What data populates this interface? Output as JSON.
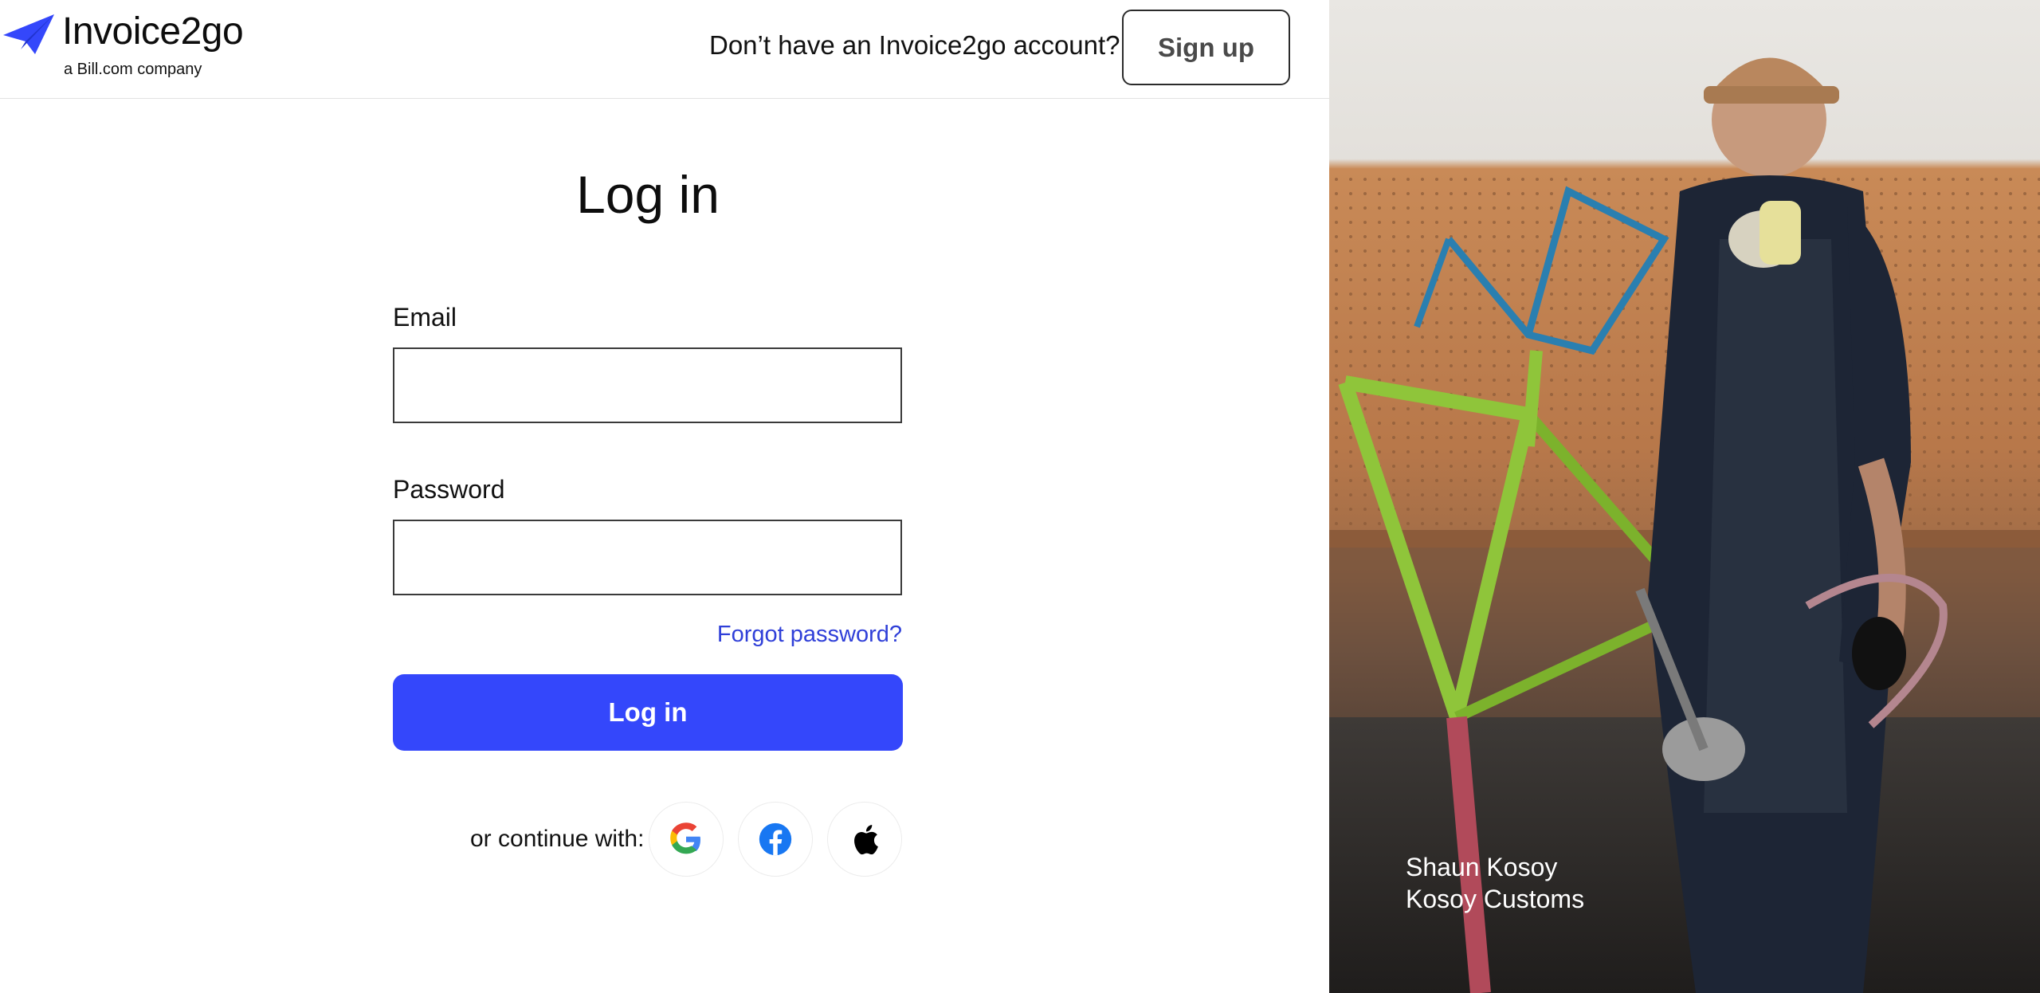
{
  "brand": {
    "name": "Invoice2go",
    "subtitle": "a Bill.com company",
    "accent": "#3447fb"
  },
  "header": {
    "signup_prompt": "Don’t have an Invoice2go account?",
    "signup_label": "Sign up"
  },
  "form": {
    "title": "Log in",
    "email_label": "Email",
    "email_value": "",
    "password_label": "Password",
    "password_value": "",
    "forgot_label": "Forgot password?",
    "submit_label": "Log in",
    "continue_label": "or continue with:"
  },
  "social": [
    "google-icon",
    "facebook-icon",
    "apple-icon"
  ],
  "photo": {
    "person_name": "Shaun Kosoy",
    "company": "Kosoy Customs"
  },
  "colors": {
    "link": "#2f3fd8",
    "button": "#3447fb",
    "facebook": "#1877f2"
  }
}
